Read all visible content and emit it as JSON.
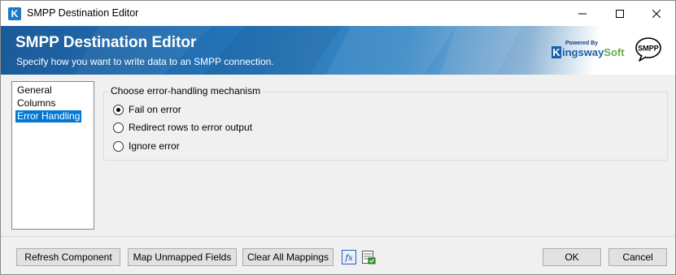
{
  "window": {
    "title": "SMPP Destination Editor",
    "app_icon_letter": "K"
  },
  "banner": {
    "title": "SMPP Destination Editor",
    "subtitle": "Specify how you want to write data to an SMPP connection.",
    "brand_powered": "Powered By",
    "brand_name_1": "ingsway",
    "brand_name_2": "Soft",
    "brand_k": "K",
    "badge_text": "SMPP"
  },
  "nav": {
    "items": [
      {
        "label": "General",
        "selected": false
      },
      {
        "label": "Columns",
        "selected": false
      },
      {
        "label": "Error Handling",
        "selected": true
      }
    ]
  },
  "error_handling": {
    "legend": "Choose error-handling mechanism",
    "options": [
      {
        "label": "Fail on error",
        "checked": true
      },
      {
        "label": "Redirect rows to error output",
        "checked": false
      },
      {
        "label": "Ignore error",
        "checked": false
      }
    ]
  },
  "footer": {
    "refresh_label": "Refresh Component",
    "map_label": "Map Unmapped Fields",
    "clear_label": "Clear All Mappings",
    "ok_label": "OK",
    "cancel_label": "Cancel"
  },
  "icons": {
    "minimize": "minimize-icon",
    "maximize": "maximize-icon",
    "close": "close-icon",
    "expression": "fx-icon",
    "sheet": "spreadsheet-icon"
  },
  "colors": {
    "selection": "#0078d7",
    "banner_dark": "#1b5a99",
    "brand_blue": "#1a5fa8",
    "brand_green": "#6aa84f"
  }
}
